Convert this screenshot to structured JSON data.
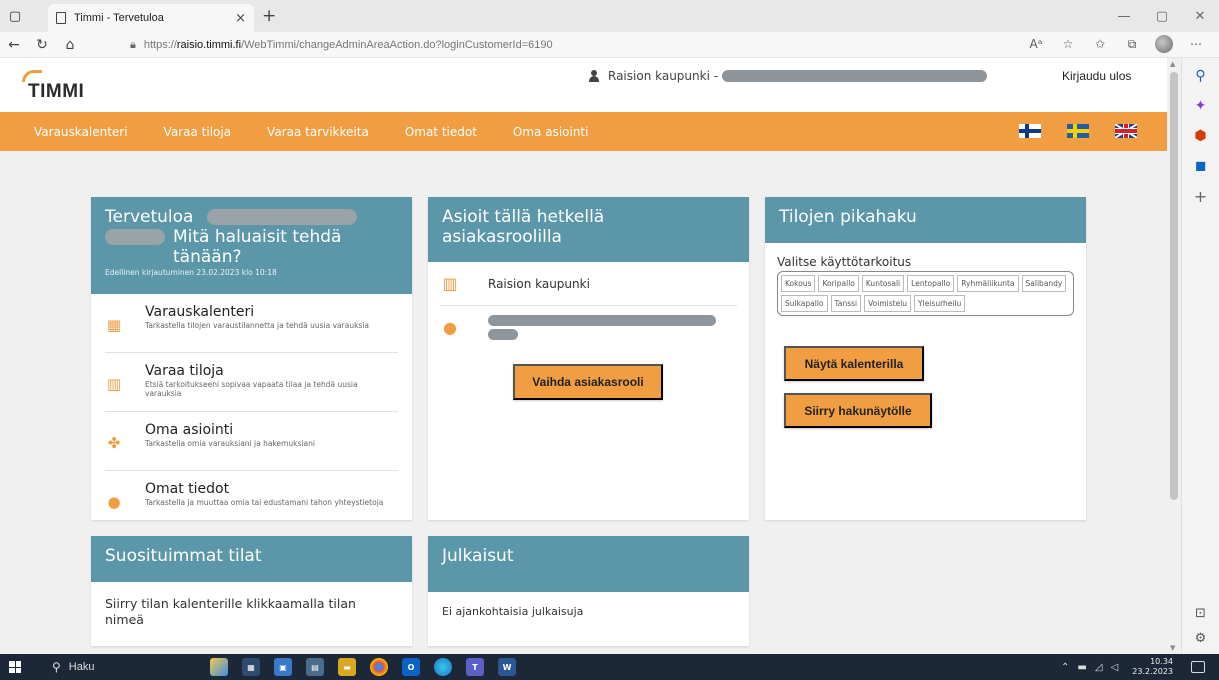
{
  "browser": {
    "tab_title": "Timmi - Tervetuloa",
    "tab_close": "×",
    "new_tab": "+",
    "url_prefix": "https://",
    "url_domain": "raisio.timmi.fi",
    "url_path": "/WebTimmi/changeAdminAreaAction.do?loginCustomerId=6190"
  },
  "header": {
    "logo_text": "TIMMI",
    "user_name": "Raision kaupunki -",
    "logout_label": "Kirjaudu ulos"
  },
  "nav": {
    "items": [
      {
        "label": "Varauskalenteri"
      },
      {
        "label": "Varaa tiloja"
      },
      {
        "label": "Varaa tarvikkeita"
      },
      {
        "label": "Omat tiedot"
      },
      {
        "label": "Oma asiointi"
      }
    ]
  },
  "welcome": {
    "title_start": "Tervetuloa",
    "title_end": "Mitä haluaisit tehdä tänään?",
    "last_login": "Edellinen kirjautuminen 23.02.2023 klo 10:18",
    "items": [
      {
        "title": "Varauskalenteri",
        "desc": "Tarkastella tilojen varaustilannetta ja tehdä uusia varauksia"
      },
      {
        "title": "Varaa tiloja",
        "desc": "Etsiä tarkoitukseeni sopivaa vapaata tilaa ja tehdä uusia varauksia"
      },
      {
        "title": "Oma asiointi",
        "desc": "Tarkastella omia varauksiani ja hakemuksiani"
      },
      {
        "title": "Omat tiedot",
        "desc": "Tarkastella ja muuttaa omia tai edustamani tahon yhteystietoja"
      }
    ]
  },
  "role": {
    "title": "Asioit tällä hetkellä asiakasroolilla",
    "org_name": "Raision kaupunki",
    "change_role_label": "Vaihda asiakasrooli"
  },
  "quick_search": {
    "title": "Tilojen pikahaku",
    "purpose_label": "Valitse käyttötarkoitus",
    "chips": [
      "Kokous",
      "Koripallo",
      "Kuntosali",
      "Lentopallo",
      "Ryhmäliikunta",
      "Salibandy",
      "Sulkapallo",
      "Tanssi",
      "Voimistelu",
      "Yleisurheilu"
    ],
    "show_calendar_label": "Näytä kalenterilla",
    "go_search_label": "Siirry hakunäytölle"
  },
  "popular": {
    "title": "Suosituimmat tilat",
    "text": "Siirry tilan kalenterille klikkaamalla tilan nimeä"
  },
  "publications": {
    "title": "Julkaisut",
    "text": "Ei ajankohtaisia julkaisuja"
  },
  "taskbar": {
    "search_label": "Haku",
    "time": "10.34",
    "date": "23.2.2023"
  },
  "colors": {
    "accent_orange": "#f09e41",
    "card_header_teal": "#5b97a8",
    "taskbar": "#1c2737"
  }
}
